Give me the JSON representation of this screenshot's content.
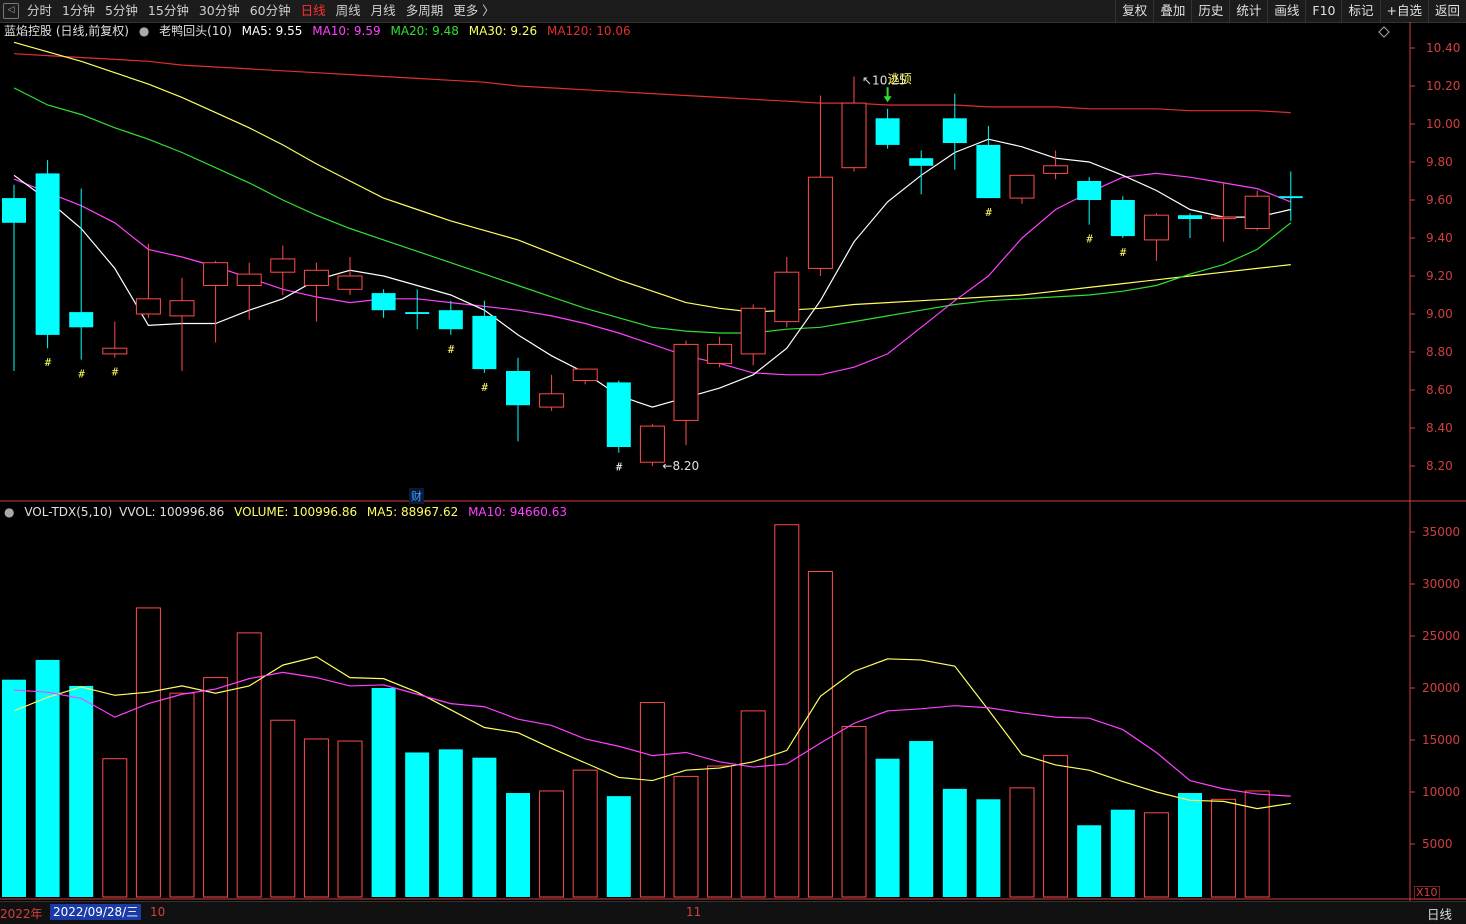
{
  "toolbar": {
    "periods": [
      "分时",
      "1分钟",
      "5分钟",
      "15分钟",
      "30分钟",
      "60分钟",
      "日线",
      "周线",
      "月线",
      "多周期",
      "更多 〉"
    ],
    "active_period": "日线",
    "buttons": [
      "复权",
      "叠加",
      "历史",
      "统计",
      "画线",
      "F10",
      "标记",
      "+自选",
      "返回"
    ]
  },
  "main_info": {
    "stock": "蓝焰控股 (日线,前复权)",
    "indicator": "老鸭回头(10)",
    "ma5": "MA5: 9.55",
    "ma10": "MA10: 9.59",
    "ma20": "MA20: 9.48",
    "ma30": "MA30: 9.26",
    "ma120": "MA120: 10.06"
  },
  "vol_info": {
    "name": "VOL-TDX(5,10)",
    "vvol": "VVOL: 100996.86",
    "volume": "VOLUME: 100996.86",
    "ma5": "MA5: 88967.62",
    "ma10": "MA10: 94660.63"
  },
  "annotations": {
    "high": "10.25",
    "low": "8.20",
    "top_label": "逃顶",
    "hash": "#",
    "finance_badge": "财"
  },
  "colors": {
    "up": "#ff4b4b",
    "down": "#00ffff",
    "ma5": "#ffffff",
    "ma10": "#ff40ff",
    "ma20": "#30e030",
    "ma30": "#ffff60",
    "ma120": "#e03030",
    "axis": "#d04040"
  },
  "status": {
    "year_text": "2022年",
    "date": "2022/09/28/三",
    "month1": "10",
    "month2": "11",
    "right": "日线",
    "vol_unit": "X10"
  },
  "chart_data": {
    "type": "candlestick",
    "price_axis": [
      10.4,
      10.2,
      10.0,
      9.8,
      9.6,
      9.4,
      9.2,
      9.0,
      8.8,
      8.6,
      8.4,
      8.2
    ],
    "volume_axis": [
      35000,
      30000,
      25000,
      20000,
      15000,
      10000,
      5000
    ],
    "candles": [
      {
        "o": 9.61,
        "c": 9.48,
        "h": 9.68,
        "l": 8.7
      },
      {
        "o": 9.74,
        "c": 8.89,
        "h": 9.81,
        "l": 8.82
      },
      {
        "o": 9.01,
        "c": 8.93,
        "h": 9.66,
        "l": 8.76
      },
      {
        "o": 8.79,
        "c": 8.82,
        "h": 8.96,
        "l": 8.77
      },
      {
        "o": 9.0,
        "c": 9.08,
        "h": 9.37,
        "l": 8.98
      },
      {
        "o": 8.99,
        "c": 9.07,
        "h": 9.19,
        "l": 8.7
      },
      {
        "o": 9.15,
        "c": 9.27,
        "h": 9.28,
        "l": 8.85
      },
      {
        "o": 9.15,
        "c": 9.21,
        "h": 9.27,
        "l": 8.97
      },
      {
        "o": 9.22,
        "c": 9.29,
        "h": 9.36,
        "l": 9.1
      },
      {
        "o": 9.15,
        "c": 9.23,
        "h": 9.27,
        "l": 8.96
      },
      {
        "o": 9.13,
        "c": 9.2,
        "h": 9.3,
        "l": 9.1
      },
      {
        "o": 9.11,
        "c": 9.02,
        "h": 9.13,
        "l": 8.98
      },
      {
        "o": 9.01,
        "c": 9.0,
        "h": 9.13,
        "l": 8.92
      },
      {
        "o": 9.02,
        "c": 8.92,
        "h": 9.07,
        "l": 8.89
      },
      {
        "o": 8.99,
        "c": 8.71,
        "h": 9.07,
        "l": 8.69
      },
      {
        "o": 8.7,
        "c": 8.52,
        "h": 8.77,
        "l": 8.33
      },
      {
        "o": 8.51,
        "c": 8.58,
        "h": 8.68,
        "l": 8.49
      },
      {
        "o": 8.65,
        "c": 8.71,
        "h": 8.71,
        "l": 8.63
      },
      {
        "o": 8.64,
        "c": 8.3,
        "h": 8.65,
        "l": 8.27
      },
      {
        "o": 8.22,
        "c": 8.41,
        "h": 8.42,
        "l": 8.2
      },
      {
        "o": 8.44,
        "c": 8.84,
        "h": 8.86,
        "l": 8.31
      },
      {
        "o": 8.74,
        "c": 8.84,
        "h": 8.88,
        "l": 8.72
      },
      {
        "o": 8.79,
        "c": 9.03,
        "h": 9.05,
        "l": 8.73
      },
      {
        "o": 8.96,
        "c": 9.22,
        "h": 9.3,
        "l": 8.93
      },
      {
        "o": 9.24,
        "c": 9.72,
        "h": 10.15,
        "l": 9.2
      },
      {
        "o": 9.77,
        "c": 10.11,
        "h": 10.25,
        "l": 9.75
      },
      {
        "o": 10.03,
        "c": 9.89,
        "h": 10.08,
        "l": 9.87
      },
      {
        "o": 9.82,
        "c": 9.78,
        "h": 9.86,
        "l": 9.63
      },
      {
        "o": 10.03,
        "c": 9.9,
        "h": 10.16,
        "l": 9.76
      },
      {
        "o": 9.89,
        "c": 9.61,
        "h": 9.99,
        "l": 9.61
      },
      {
        "o": 9.61,
        "c": 9.73,
        "h": 9.73,
        "l": 9.58
      },
      {
        "o": 9.74,
        "c": 9.78,
        "h": 9.86,
        "l": 9.71
      },
      {
        "o": 9.7,
        "c": 9.6,
        "h": 9.72,
        "l": 9.47
      },
      {
        "o": 9.6,
        "c": 9.41,
        "h": 9.62,
        "l": 9.4
      },
      {
        "o": 9.39,
        "c": 9.52,
        "h": 9.53,
        "l": 9.28
      },
      {
        "o": 9.52,
        "c": 9.5,
        "h": 9.53,
        "l": 9.4
      },
      {
        "o": 9.51,
        "c": 9.51,
        "h": 9.69,
        "l": 9.38
      },
      {
        "o": 9.45,
        "c": 9.62,
        "h": 9.65,
        "l": 9.44
      },
      {
        "o": 9.62,
        "c": 9.61,
        "h": 9.75,
        "l": 9.49
      }
    ],
    "ma5": [
      9.73,
      9.6,
      9.45,
      9.24,
      8.94,
      8.95,
      8.95,
      9.02,
      9.08,
      9.18,
      9.23,
      9.2,
      9.15,
      9.1,
      9.02,
      8.89,
      8.78,
      8.69,
      8.57,
      8.51,
      8.56,
      8.61,
      8.68,
      8.82,
      9.07,
      9.38,
      9.59,
      9.73,
      9.85,
      9.92,
      9.88,
      9.82,
      9.8,
      9.73,
      9.65,
      9.55,
      9.51,
      9.51,
      9.55
    ],
    "ma10": [
      9.71,
      9.64,
      9.57,
      9.48,
      9.34,
      9.3,
      9.25,
      9.19,
      9.13,
      9.09,
      9.06,
      9.08,
      9.08,
      9.06,
      9.04,
      9.02,
      8.99,
      8.95,
      8.9,
      8.84,
      8.78,
      8.74,
      8.69,
      8.68,
      8.68,
      8.72,
      8.79,
      8.93,
      9.07,
      9.2,
      9.4,
      9.55,
      9.64,
      9.72,
      9.74,
      9.72,
      9.69,
      9.66,
      9.59
    ],
    "ma20": [
      10.19,
      10.1,
      10.05,
      9.98,
      9.92,
      9.85,
      9.77,
      9.69,
      9.6,
      9.52,
      9.45,
      9.39,
      9.33,
      9.27,
      9.21,
      9.15,
      9.09,
      9.03,
      8.98,
      8.93,
      8.91,
      8.9,
      8.9,
      8.92,
      8.93,
      8.96,
      8.99,
      9.02,
      9.05,
      9.07,
      9.08,
      9.09,
      9.1,
      9.12,
      9.15,
      9.21,
      9.26,
      9.34,
      9.48
    ],
    "ma30": [
      10.43,
      10.38,
      10.33,
      10.27,
      10.21,
      10.14,
      10.06,
      9.98,
      9.89,
      9.79,
      9.7,
      9.61,
      9.55,
      9.49,
      9.44,
      9.39,
      9.32,
      9.25,
      9.18,
      9.12,
      9.06,
      9.03,
      9.01,
      9.02,
      9.03,
      9.05,
      9.06,
      9.07,
      9.08,
      9.09,
      9.1,
      9.12,
      9.14,
      9.16,
      9.18,
      9.2,
      9.22,
      9.24,
      9.26
    ],
    "ma120": [
      10.37,
      10.36,
      10.35,
      10.34,
      10.33,
      10.31,
      10.3,
      10.29,
      10.28,
      10.27,
      10.26,
      10.25,
      10.24,
      10.23,
      10.22,
      10.2,
      10.19,
      10.18,
      10.17,
      10.16,
      10.15,
      10.14,
      10.13,
      10.12,
      10.11,
      10.11,
      10.1,
      10.1,
      10.1,
      10.09,
      10.09,
      10.09,
      10.08,
      10.08,
      10.08,
      10.07,
      10.07,
      10.07,
      10.06
    ],
    "volumes": [
      20800,
      22700,
      20200,
      13200,
      27700,
      19500,
      21000,
      25300,
      16900,
      15100,
      14900,
      20000,
      13800,
      14100,
      13300,
      9900,
      10100,
      12100,
      9600,
      18600,
      11500,
      12500,
      17800,
      35700,
      31200,
      16300,
      13200,
      14900,
      10300,
      9300,
      10400,
      13500,
      6800,
      8300,
      8000,
      9900,
      9300,
      10100
    ],
    "vol_ma5": [
      17800,
      19100,
      20100,
      19300,
      19600,
      20200,
      19500,
      20200,
      22200,
      23000,
      21000,
      20900,
      19600,
      17900,
      16200,
      15700,
      14200,
      12800,
      11400,
      11100,
      12100,
      12300,
      12900,
      14000,
      19200,
      21600,
      22800,
      22700,
      22100,
      17900,
      13600,
      12600,
      12100,
      11000,
      10000,
      9200,
      9100,
      8400,
      8900
    ],
    "vol_ma10": [
      19800,
      19600,
      19000,
      17200,
      18500,
      19400,
      19900,
      20900,
      21500,
      21000,
      20200,
      20300,
      19400,
      18500,
      18200,
      17000,
      16400,
      15100,
      14400,
      13500,
      13800,
      12900,
      12400,
      12700,
      14700,
      16600,
      17800,
      18000,
      18300,
      18100,
      17600,
      17200,
      17100,
      16000,
      13800,
      11100,
      10300,
      9800,
      9600
    ],
    "hash_markers": [
      1,
      2,
      3,
      13,
      14,
      18,
      29,
      32,
      33
    ]
  }
}
